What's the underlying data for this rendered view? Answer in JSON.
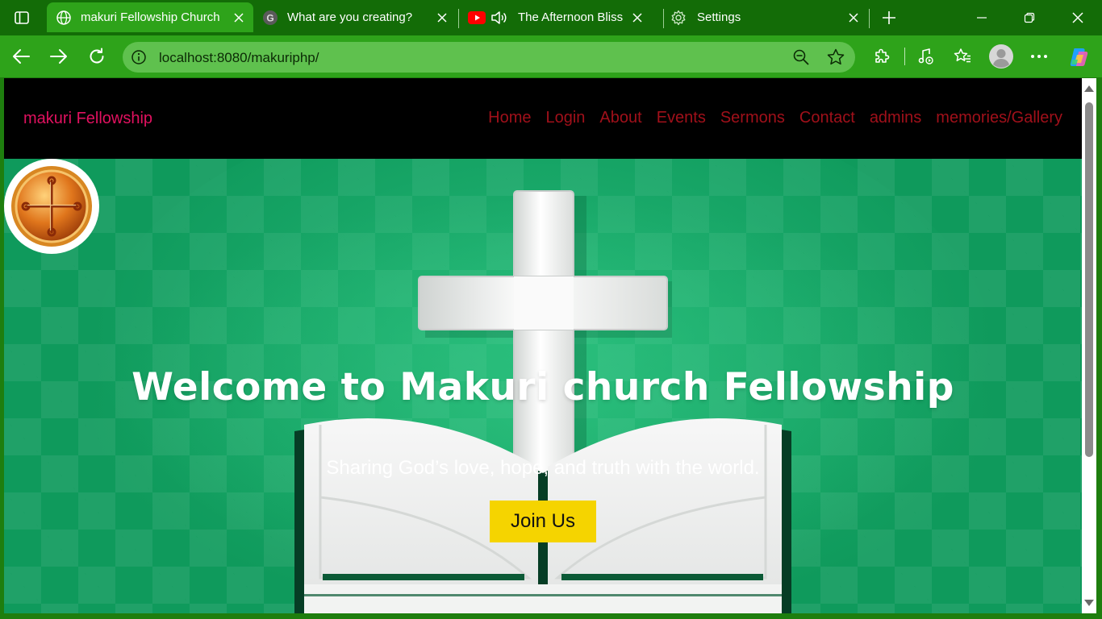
{
  "browser": {
    "tabs": [
      {
        "title": "makuri Fellowship Church",
        "favicon": "globe-icon",
        "active": true
      },
      {
        "title": "What are you creating?",
        "favicon": "g-logo-icon",
        "active": false
      },
      {
        "title": "The Afternoon Bliss",
        "favicon": "youtube-icon",
        "audio": "speaker-icon",
        "active": false
      },
      {
        "title": "Settings",
        "favicon": "gear-icon",
        "active": false
      }
    ],
    "address": "localhost:8080/makuriphp/"
  },
  "site": {
    "brand": "makuri Fellowship",
    "nav": [
      "Home",
      "Login",
      "About",
      "Events",
      "Sermons",
      "Contact",
      "admins",
      "memories/Gallery"
    ],
    "hero": {
      "title": "Welcome to Makuri church Fellowship",
      "subtitle": "Sharing God’s love, hope, and truth with the world.",
      "cta": "Join Us"
    }
  },
  "colors": {
    "tabstrip": "#136c07",
    "toolbar": "#2ea31a",
    "brand": "#e0115f",
    "nav_link": "#a0101a",
    "hero_green": "#0f9a5c",
    "cta": "#f5d400"
  }
}
